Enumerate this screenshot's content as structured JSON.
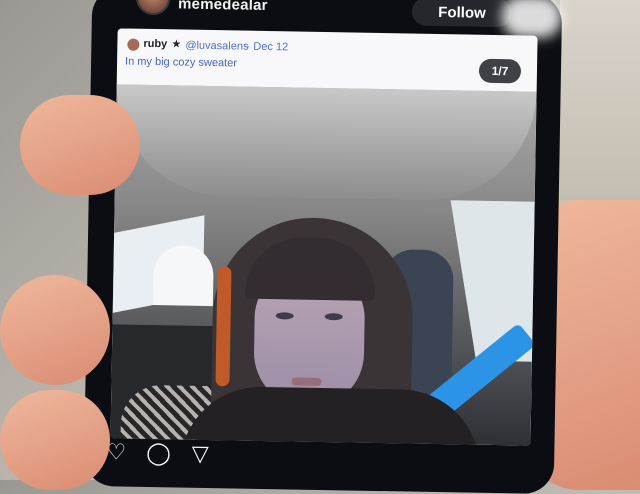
{
  "post": {
    "username": "memedealar",
    "follow_label": "Follow"
  },
  "embedded": {
    "display_name": "ruby",
    "star": "★",
    "handle": "@luvasalens",
    "separator": "·",
    "date": "Dec 12",
    "caption": "In my big cozy sweater",
    "counter": "1/7"
  },
  "icons": {
    "like": "heart-icon",
    "comment": "comment-icon",
    "share": "send-icon"
  },
  "colors": {
    "app_background": "#0c0d12",
    "link_blue": "#4b72c6",
    "follow_button": "#26272c"
  }
}
